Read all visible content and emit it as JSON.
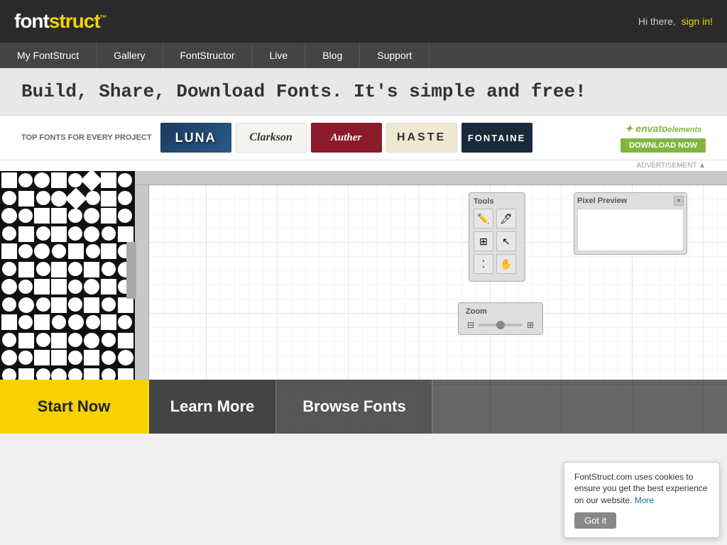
{
  "header": {
    "logo_font": "font",
    "logo_struct": "struct",
    "logo_tm": "™",
    "greeting": "Hi there,",
    "signin_label": "sign in!"
  },
  "nav": {
    "items": [
      {
        "label": "My FontStruct",
        "id": "my-fontstruct"
      },
      {
        "label": "Gallery",
        "id": "gallery"
      },
      {
        "label": "FontStructor",
        "id": "fontstructor"
      },
      {
        "label": "Live",
        "id": "live"
      },
      {
        "label": "Blog",
        "id": "blog"
      },
      {
        "label": "Support",
        "id": "support"
      }
    ]
  },
  "hero": {
    "headline": "Build, Share, Download Fonts. It's simple and free!"
  },
  "ad_banner": {
    "label": "TOP FONTS FOR EVERY PROJECT",
    "fonts": [
      {
        "name": "LUNA",
        "style": "luna"
      },
      {
        "name": "Clarkson",
        "style": "clarkson"
      },
      {
        "name": "Auther",
        "style": "auther"
      },
      {
        "name": "HASTE",
        "style": "haste"
      },
      {
        "name": "FONTAINE",
        "style": "fontaine"
      }
    ],
    "envato_label": "envato elements",
    "download_label": "DOWNLOAD NOW",
    "ad_notice": "ADVERTISEMENT ▲"
  },
  "tools": {
    "title": "Tools",
    "zoom_title": "Zoom"
  },
  "pixel_preview": {
    "title": "Pixel Preview",
    "close_label": "×"
  },
  "cta": {
    "start_now": "Start Now",
    "learn_more": "Learn More",
    "browse_fonts": "Browse Fonts"
  },
  "cookie": {
    "text": "FontStruct.com uses cookies to ensure you get the best experience on our website.",
    "more_label": "More",
    "button_label": "Got it"
  }
}
